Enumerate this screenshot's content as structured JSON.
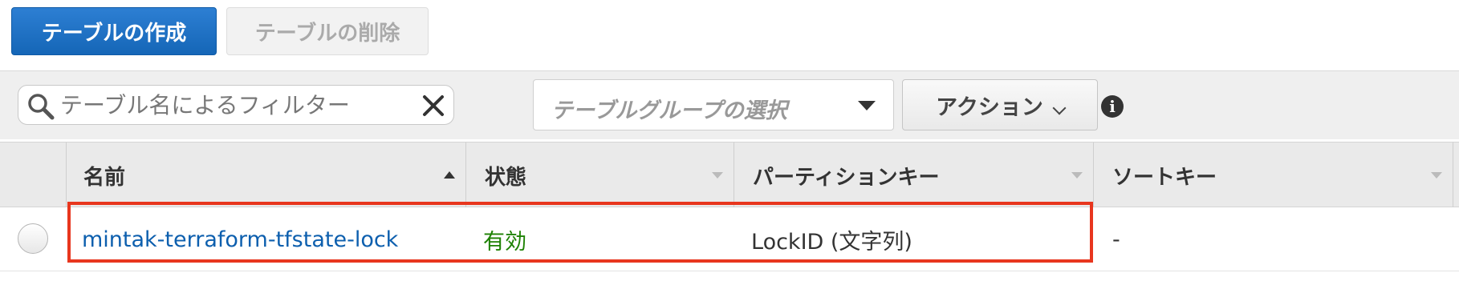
{
  "toolbar": {
    "create_table_label": "テーブルの作成",
    "delete_table_label": "テーブルの削除"
  },
  "filter": {
    "placeholder": "テーブル名によるフィルター",
    "group_select_placeholder": "テーブルグループの選択",
    "action_label": "アクション"
  },
  "icons": {
    "search": "search-icon",
    "clear": "close-icon",
    "dropdown": "caret-down-icon",
    "action_chevron": "chevron-down-icon",
    "info": "info-icon"
  },
  "table": {
    "columns": [
      {
        "label": "名前",
        "sort": "ascending"
      },
      {
        "label": "状態",
        "sort": "none"
      },
      {
        "label": "パーティションキー",
        "sort": "none"
      },
      {
        "label": "ソートキー",
        "sort": "none"
      }
    ],
    "rows": [
      {
        "name": "mintak-terraform-tfstate-lock",
        "status": "有効",
        "partition_key": "LockID (文字列)",
        "sort_key": "-"
      }
    ]
  },
  "colors": {
    "primary": "#1566b7",
    "link": "#0d5fae",
    "status_active": "#1d8102",
    "highlight": "#e8361e"
  }
}
